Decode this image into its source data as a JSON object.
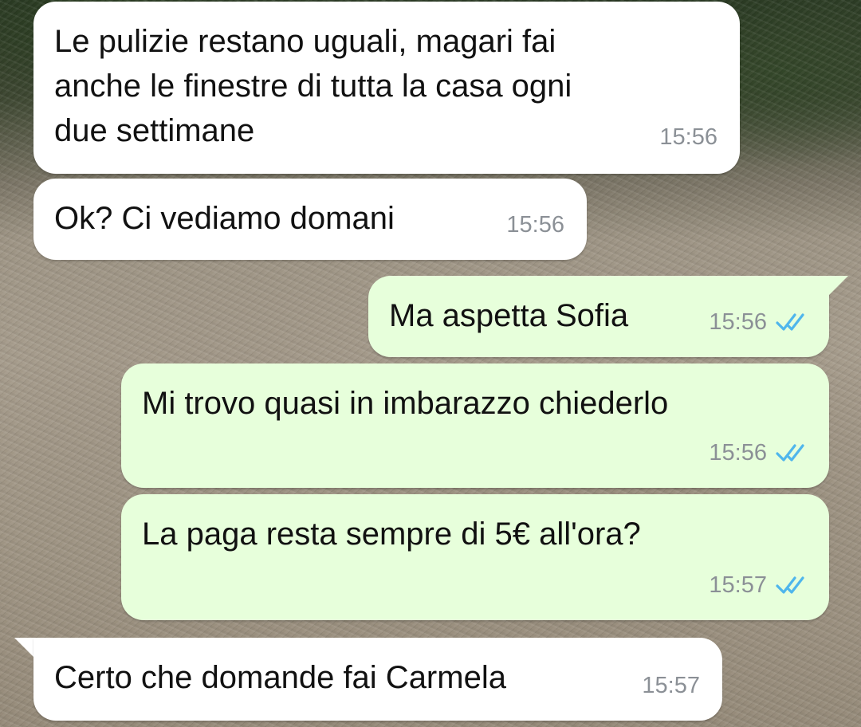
{
  "messages": [
    {
      "direction": "incoming",
      "text": "Le pulizie restano uguali, magari fai\nanche le finestre di tutta la casa ogni\ndue settimane",
      "time": "15:56"
    },
    {
      "direction": "incoming",
      "text": "Ok? Ci vediamo domani",
      "time": "15:56"
    },
    {
      "direction": "outgoing",
      "text": "Ma aspetta Sofia",
      "time": "15:56",
      "status_icon": "double-check-read-icon"
    },
    {
      "direction": "outgoing",
      "text": "Mi trovo quasi in imbarazzo chiederlo",
      "time": "15:56",
      "status_icon": "double-check-read-icon"
    },
    {
      "direction": "outgoing",
      "text": "La paga resta sempre di 5€ all'ora?",
      "time": "15:57",
      "status_icon": "double-check-read-icon"
    },
    {
      "direction": "incoming",
      "text": "Certo che domande fai Carmela",
      "time": "15:57"
    }
  ],
  "colors": {
    "incoming_bubble": "#ffffff",
    "outgoing_bubble": "#e7ffdb",
    "read_tick": "#4fb6ec",
    "timestamp": "#8b9096"
  }
}
